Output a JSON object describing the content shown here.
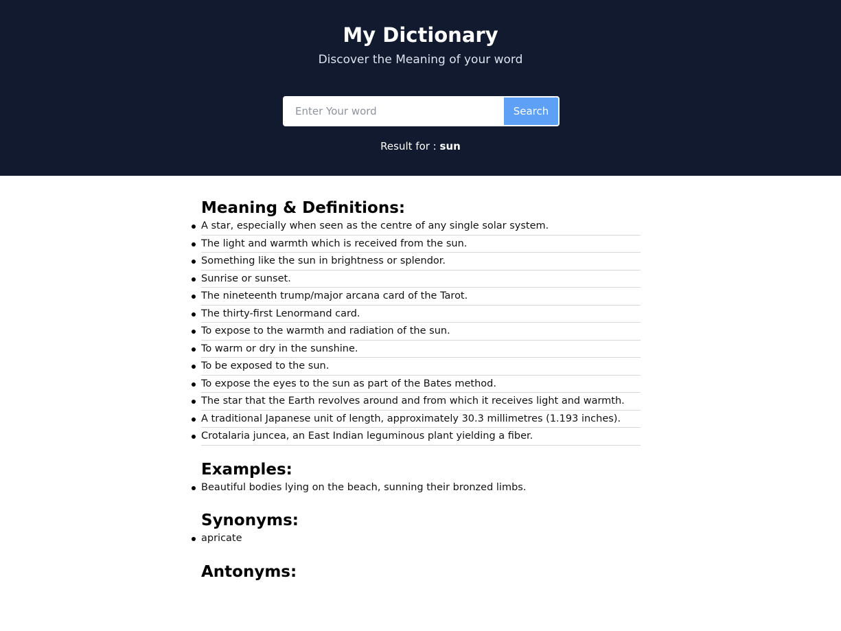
{
  "header": {
    "title": "My Dictionary",
    "subtitle": "Discover the Meaning of your word"
  },
  "search": {
    "placeholder": "Enter Your word",
    "value": "",
    "button_label": "Search"
  },
  "result": {
    "prefix": "Result for :",
    "word": "sun"
  },
  "sections": {
    "definitions": {
      "title": "Meaning & Definitions:",
      "items": [
        "A star, especially when seen as the centre of any single solar system.",
        "The light and warmth which is received from the sun.",
        "Something like the sun in brightness or splendor.",
        "Sunrise or sunset.",
        "The nineteenth trump/major arcana card of the Tarot.",
        "The thirty-first Lenormand card.",
        "To expose to the warmth and radiation of the sun.",
        "To warm or dry in the sunshine.",
        "To be exposed to the sun.",
        "To expose the eyes to the sun as part of the Bates method.",
        "The star that the Earth revolves around and from which it receives light and warmth.",
        "A traditional Japanese unit of length, approximately 30.3 millimetres (1.193 inches).",
        "Crotalaria juncea, an East Indian leguminous plant yielding a fiber."
      ]
    },
    "examples": {
      "title": "Examples:",
      "items": [
        "Beautiful bodies lying on the beach, sunning their bronzed limbs."
      ]
    },
    "synonyms": {
      "title": "Synonyms:",
      "items": [
        "apricate"
      ]
    },
    "antonyms": {
      "title": "Antonyms:",
      "items": []
    }
  }
}
